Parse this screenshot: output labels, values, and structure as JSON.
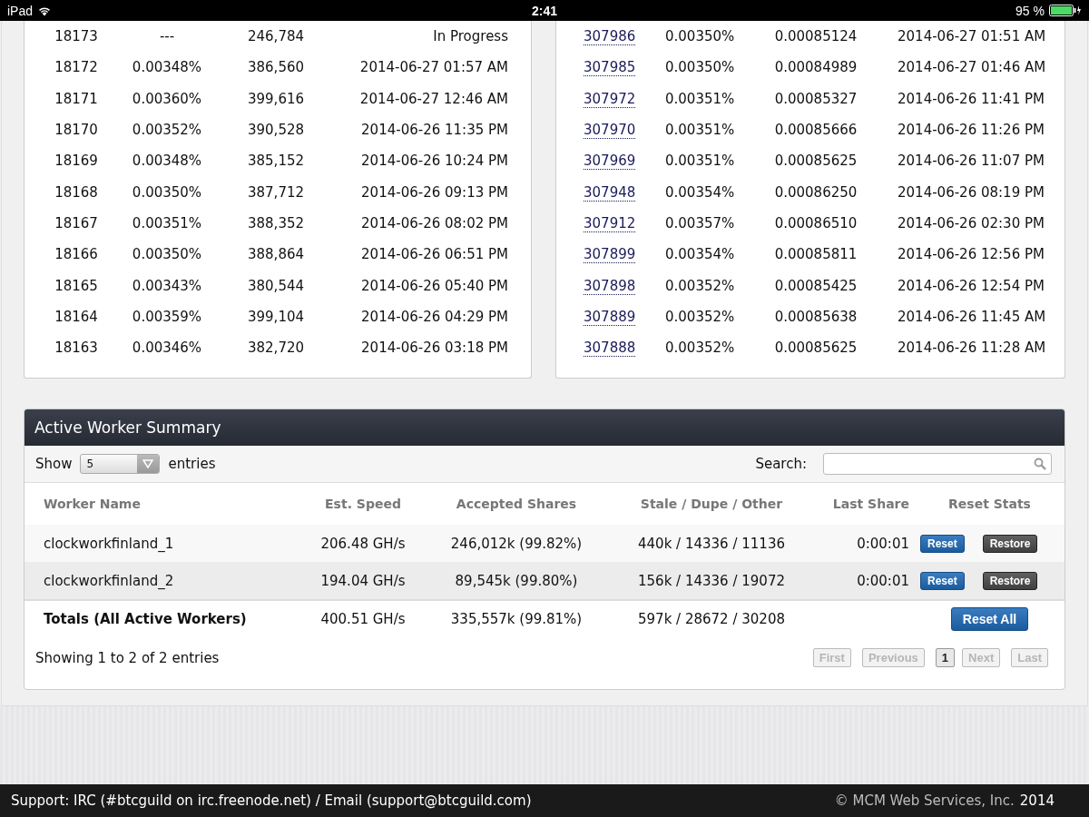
{
  "status_bar": {
    "device": "iPad",
    "time": "2:41",
    "battery": "95 %"
  },
  "left_table": {
    "rows": [
      {
        "block": "18173",
        "share": "---",
        "column_3": "246,784",
        "time": "In Progress"
      },
      {
        "block": "18172",
        "share": "0.00348%",
        "column_3": "386,560",
        "time": "2014-06-27 01:57 AM"
      },
      {
        "block": "18171",
        "share": "0.00360%",
        "column_3": "399,616",
        "time": "2014-06-27 12:46 AM"
      },
      {
        "block": "18170",
        "share": "0.00352%",
        "column_3": "390,528",
        "time": "2014-06-26 11:35 PM"
      },
      {
        "block": "18169",
        "share": "0.00348%",
        "column_3": "385,152",
        "time": "2014-06-26 10:24 PM"
      },
      {
        "block": "18168",
        "share": "0.00350%",
        "column_3": "387,712",
        "time": "2014-06-26 09:13 PM"
      },
      {
        "block": "18167",
        "share": "0.00351%",
        "column_3": "388,352",
        "time": "2014-06-26 08:02 PM"
      },
      {
        "block": "18166",
        "share": "0.00350%",
        "column_3": "388,864",
        "time": "2014-06-26 06:51 PM"
      },
      {
        "block": "18165",
        "share": "0.00343%",
        "column_3": "380,544",
        "time": "2014-06-26 05:40 PM"
      },
      {
        "block": "18164",
        "share": "0.00359%",
        "column_3": "399,104",
        "time": "2014-06-26 04:29 PM"
      },
      {
        "block": "18163",
        "share": "0.00346%",
        "column_3": "382,720",
        "time": "2014-06-26 03:18 PM"
      }
    ]
  },
  "right_table": {
    "rows": [
      {
        "block": "307986",
        "share": "0.00350%",
        "reward": "0.00085124",
        "time": "2014-06-27 01:51 AM"
      },
      {
        "block": "307985",
        "share": "0.00350%",
        "reward": "0.00084989",
        "time": "2014-06-27 01:46 AM"
      },
      {
        "block": "307972",
        "share": "0.00351%",
        "reward": "0.00085327",
        "time": "2014-06-26 11:41 PM"
      },
      {
        "block": "307970",
        "share": "0.00351%",
        "reward": "0.00085666",
        "time": "2014-06-26 11:26 PM"
      },
      {
        "block": "307969",
        "share": "0.00351%",
        "reward": "0.00085625",
        "time": "2014-06-26 11:07 PM"
      },
      {
        "block": "307948",
        "share": "0.00354%",
        "reward": "0.00086250",
        "time": "2014-06-26 08:19 PM"
      },
      {
        "block": "307912",
        "share": "0.00357%",
        "reward": "0.00086510",
        "time": "2014-06-26 02:30 PM"
      },
      {
        "block": "307899",
        "share": "0.00354%",
        "reward": "0.00085811",
        "time": "2014-06-26 12:56 PM"
      },
      {
        "block": "307898",
        "share": "0.00352%",
        "reward": "0.00085425",
        "time": "2014-06-26 12:54 PM"
      },
      {
        "block": "307889",
        "share": "0.00352%",
        "reward": "0.00085638",
        "time": "2014-06-26 11:45 AM"
      },
      {
        "block": "307888",
        "share": "0.00352%",
        "reward": "0.00085625",
        "time": "2014-06-26 11:28 AM"
      }
    ]
  },
  "worker_summary": {
    "title": "Active Worker Summary",
    "show_label": "Show",
    "page_size": "5",
    "entries_label": "entries",
    "search_label": "Search:",
    "columns": [
      "Worker Name",
      "Est. Speed",
      "Accepted Shares",
      "Stale / Dupe / Other",
      "Last Share",
      "Reset Stats"
    ],
    "rows": [
      {
        "name": "clockworkfinland_1",
        "speed": "206.48 GH/s",
        "accepted": "246,012k (99.82%)",
        "stale": "440k / 14336 / 11136",
        "last_share": "0:00:01",
        "reset": "Reset",
        "restore": "Restore"
      },
      {
        "name": "clockworkfinland_2",
        "speed": "194.04 GH/s",
        "accepted": "89,545k (99.80%)",
        "stale": "156k / 14336 / 19072",
        "last_share": "0:00:01",
        "reset": "Reset",
        "restore": "Restore"
      }
    ],
    "totals": {
      "name": "Totals (All Active Workers)",
      "speed": "400.51 GH/s",
      "accepted": "335,557k (99.81%)",
      "stale": "597k / 28672 / 30208",
      "reset_all": "Reset All"
    },
    "info": "Showing 1 to 2 of 2 entries",
    "pagination": [
      {
        "label": "First",
        "disabled": true,
        "selected": false
      },
      {
        "label": "Previous",
        "disabled": true,
        "selected": false
      },
      {
        "label": "1",
        "disabled": false,
        "selected": true
      },
      {
        "label": "Next",
        "disabled": true,
        "selected": false
      },
      {
        "label": "Last",
        "disabled": true,
        "selected": false
      }
    ]
  },
  "footer": {
    "support": "Support: IRC (#btcguild on irc.freenode.net) / Email (support@btcguild.com)",
    "copyright": "© MCM Web Services, Inc.",
    "year": "2014"
  }
}
